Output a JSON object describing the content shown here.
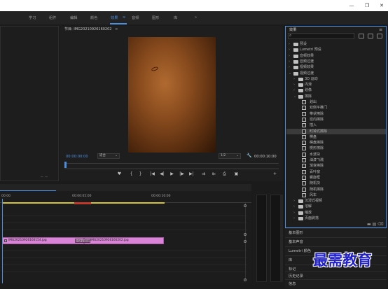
{
  "menubar": {
    "items": [
      "学习",
      "组件",
      "编辑",
      "颜色",
      "效果",
      "音频",
      "图形",
      "库",
      "»"
    ],
    "active_index": 4,
    "active_suffix": "≡"
  },
  "window_controls": [
    "—",
    "❐",
    "✕"
  ],
  "program": {
    "title": "节目: IMG20210926160202",
    "title_menu": "≡",
    "timecode_left": "00:00:00:00",
    "fit_value": "适合",
    "resolution_value": "1/2",
    "timecode_right": "00:00:10:00",
    "controls": [
      "♥",
      "{",
      "}",
      "|◀",
      "◀|",
      "▶",
      "|▶",
      "▶|",
      "⇉",
      "⇇",
      "⎙",
      "▣",
      "+"
    ]
  },
  "effects": {
    "title": "效果",
    "menu_icon": "≡",
    "search_placeholder": "",
    "tree": [
      {
        "label": "预设",
        "level": 0,
        "kind": "folder",
        "twisty": "›"
      },
      {
        "label": "Lumetri 预设",
        "level": 0,
        "kind": "folder",
        "twisty": "›"
      },
      {
        "label": "音频效果",
        "level": 0,
        "kind": "folder",
        "twisty": "›"
      },
      {
        "label": "音频过渡",
        "level": 0,
        "kind": "folder",
        "twisty": "›"
      },
      {
        "label": "视频效果",
        "level": 0,
        "kind": "folder",
        "twisty": "›"
      },
      {
        "label": "视频过渡",
        "level": 0,
        "kind": "folder",
        "twisty": "⌄"
      },
      {
        "label": "3D 运动",
        "level": 1,
        "kind": "folder",
        "twisty": "›"
      },
      {
        "label": "内滑",
        "level": 1,
        "kind": "folder",
        "twisty": "›"
      },
      {
        "label": "划像",
        "level": 1,
        "kind": "folder",
        "twisty": "›"
      },
      {
        "label": "擦除",
        "level": 1,
        "kind": "folder",
        "twisty": "⌄"
      },
      {
        "label": "划出",
        "level": 2,
        "kind": "effect"
      },
      {
        "label": "双侧平推门",
        "level": 2,
        "kind": "effect"
      },
      {
        "label": "带状擦除",
        "level": 2,
        "kind": "effect"
      },
      {
        "label": "径向擦除",
        "level": 2,
        "kind": "effect"
      },
      {
        "label": "插入",
        "level": 2,
        "kind": "effect"
      },
      {
        "label": "时钟式擦除",
        "level": 2,
        "kind": "effect",
        "selected": true
      },
      {
        "label": "棋盘",
        "level": 2,
        "kind": "effect"
      },
      {
        "label": "棋盘擦除",
        "level": 2,
        "kind": "effect"
      },
      {
        "label": "楔形擦除",
        "level": 2,
        "kind": "effect"
      },
      {
        "label": "水波块",
        "level": 2,
        "kind": "effect"
      },
      {
        "label": "油漆飞溅",
        "level": 2,
        "kind": "effect"
      },
      {
        "label": "渐变擦除",
        "level": 2,
        "kind": "effect"
      },
      {
        "label": "百叶窗",
        "level": 2,
        "kind": "effect"
      },
      {
        "label": "螺旋框",
        "level": 2,
        "kind": "effect"
      },
      {
        "label": "随机块",
        "level": 2,
        "kind": "effect"
      },
      {
        "label": "随机擦除",
        "level": 2,
        "kind": "effect"
      },
      {
        "label": "风车",
        "level": 2,
        "kind": "effect"
      },
      {
        "label": "沉浸式视频",
        "level": 1,
        "kind": "folder",
        "twisty": "›"
      },
      {
        "label": "溶解",
        "level": 1,
        "kind": "folder",
        "twisty": "›"
      },
      {
        "label": "缩放",
        "level": 1,
        "kind": "folder",
        "twisty": "›"
      },
      {
        "label": "页面剥落",
        "level": 1,
        "kind": "folder",
        "twisty": "›"
      }
    ],
    "bottom_icons": "▬ ▤ ⌫"
  },
  "lower_panels": [
    "基本图形",
    "基本声音",
    "Lumetri 颜色",
    "库",
    "标记",
    "历史记录",
    "信息"
  ],
  "timeline": {
    "times": [
      "00:00",
      "00:00:05:00",
      "00:00:10:00"
    ],
    "clips": [
      {
        "label": "IMG20210926160154.jpg"
      },
      {
        "label": "IMG20210926160202.jpg"
      }
    ],
    "transition_label": "时钟式擦除"
  },
  "watermark": "最需教育",
  "colors": {
    "accent": "#4a8fe0",
    "clip": "#d984d6",
    "workarea": "#d3c43b",
    "watermark": "#2222cc"
  }
}
